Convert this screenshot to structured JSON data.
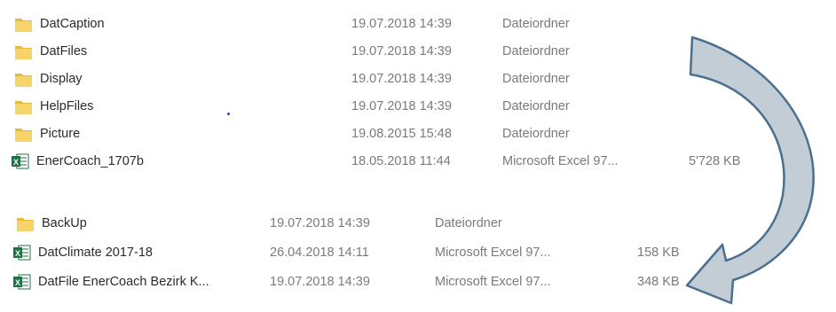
{
  "group_a": [
    {
      "icon": "folder",
      "name": "DatCaption",
      "date": "19.07.2018 14:39",
      "type": "Dateiordner",
      "size": ""
    },
    {
      "icon": "folder",
      "name": "DatFiles",
      "date": "19.07.2018 14:39",
      "type": "Dateiordner",
      "size": ""
    },
    {
      "icon": "folder",
      "name": "Display",
      "date": "19.07.2018 14:39",
      "type": "Dateiordner",
      "size": ""
    },
    {
      "icon": "folder",
      "name": "HelpFiles",
      "date": "19.07.2018 14:39",
      "type": "Dateiordner",
      "size": ""
    },
    {
      "icon": "folder",
      "name": "Picture",
      "date": "19.08.2015 15:48",
      "type": "Dateiordner",
      "size": ""
    },
    {
      "icon": "excel",
      "name": "EnerCoach_1707b",
      "date": "18.05.2018 11:44",
      "type": "Microsoft Excel 97...",
      "size": "5'728 KB"
    }
  ],
  "group_b": [
    {
      "icon": "folder",
      "name": "BackUp",
      "date": "19.07.2018 14:39",
      "type": "Dateiordner",
      "size": ""
    },
    {
      "icon": "excel",
      "name": "DatClimate 2017-18",
      "date": "26.04.2018 14:11",
      "type": "Microsoft Excel 97...",
      "size": "158 KB"
    },
    {
      "icon": "excel",
      "name": "DatFile EnerCoach Bezirk K...",
      "date": "19.07.2018 14:39",
      "type": "Microsoft Excel 97...",
      "size": "348 KB"
    }
  ],
  "colors": {
    "folder": "#f7d46b",
    "folder_tab": "#e9b93a",
    "excel": "#1e7145",
    "arrow_fill": "#c3cdd6",
    "arrow_stroke": "#4a6f8f"
  }
}
